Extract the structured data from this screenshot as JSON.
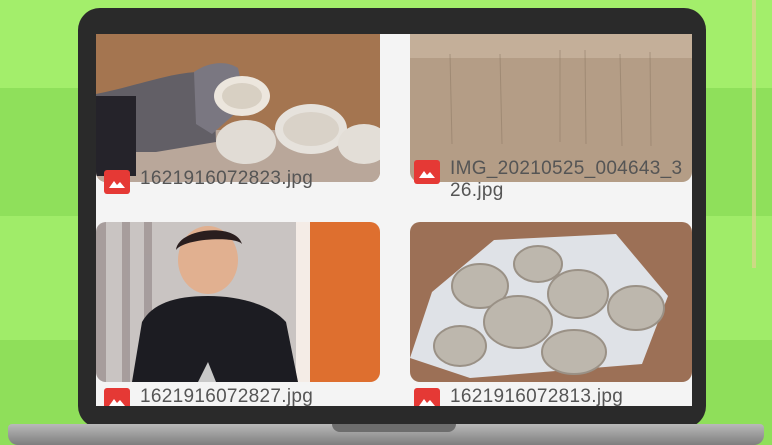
{
  "files": [
    {
      "name": "1621916072823.jpg",
      "icon": "image-file-icon"
    },
    {
      "name": "IMG_20210525_004643_326.jpg",
      "icon": "image-file-icon"
    },
    {
      "name": "1621916072827.jpg",
      "icon": "image-file-icon"
    },
    {
      "name": "1621916072813.jpg",
      "icon": "image-file-icon"
    }
  ],
  "colors": {
    "background": "#9bea63",
    "icon": "#e53935",
    "laptop_frame": "#2a2a2a",
    "screen": "#f4f4f4"
  }
}
